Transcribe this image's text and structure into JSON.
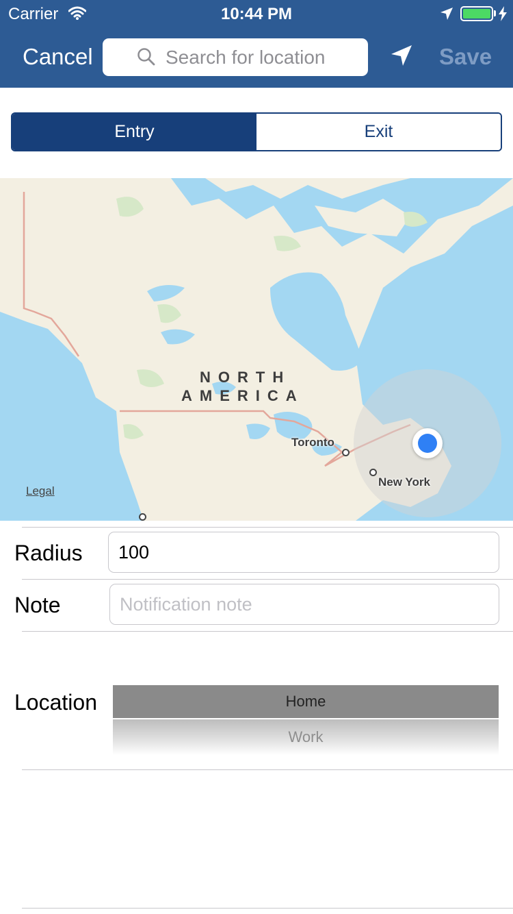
{
  "status_bar": {
    "carrier": "Carrier",
    "time": "10:44 PM",
    "battery_color": "#4cd964"
  },
  "nav": {
    "cancel_label": "Cancel",
    "search_placeholder": "Search for location",
    "locate_icon": "location-arrow-icon",
    "save_label": "Save"
  },
  "segmented": {
    "options": [
      "Entry",
      "Exit"
    ],
    "selected": "Entry"
  },
  "map": {
    "region_label_line1": "NORTH",
    "region_label_line2": "AMERICA",
    "cities": [
      "Toronto",
      "New York"
    ],
    "legal_label": "Legal"
  },
  "form": {
    "radius_label": "Radius",
    "radius_value": "100",
    "note_label": "Note",
    "note_placeholder": "Notification note",
    "location_label": "Location",
    "location_options": [
      "Home",
      "Work"
    ],
    "location_selected": "Home"
  },
  "colors": {
    "nav_bar": "#2d5b94",
    "segment_accent": "#173f7a",
    "save_disabled": "#7e9cc4",
    "user_location": "#2f80f5"
  }
}
